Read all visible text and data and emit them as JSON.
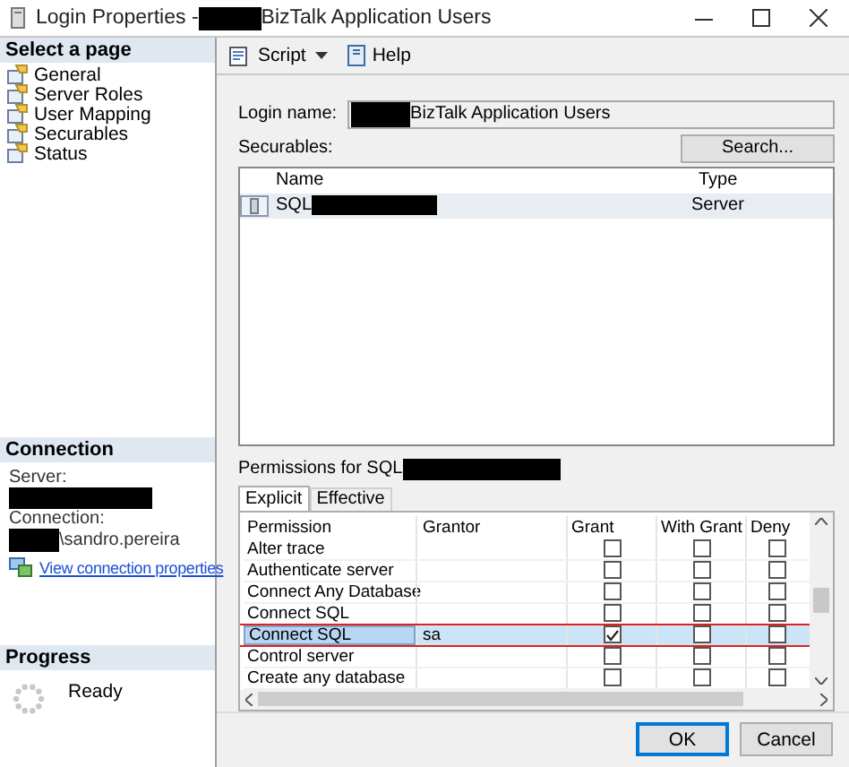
{
  "window": {
    "title": [
      {
        "kind": "text",
        "text": "Login Properties -"
      },
      {
        "kind": "redacted"
      },
      {
        "kind": "text",
        "text": "BizTalk Application Users"
      }
    ]
  },
  "sidebar": {
    "header": "Select a page",
    "items": [
      {
        "label": "General"
      },
      {
        "label": "Server Roles"
      },
      {
        "label": "User Mapping"
      },
      {
        "label": "Securables"
      },
      {
        "label": "Status"
      }
    ]
  },
  "connection": {
    "header": "Connection",
    "server_label": "Server:",
    "server_value": [
      {
        "kind": "redacted"
      }
    ],
    "connection_label": "Connection:",
    "connection_value": [
      {
        "kind": "redacted"
      },
      {
        "kind": "text",
        "text": "\\sandro.pereira"
      }
    ],
    "link": "View connection properties"
  },
  "progress": {
    "header": "Progress",
    "status": "Ready"
  },
  "toolbar": {
    "buttons": [
      {
        "label": "Script",
        "kind": "menu"
      },
      {
        "label": "Help",
        "kind": "plain"
      }
    ]
  },
  "login_name": {
    "label": "Login name:",
    "value": [
      {
        "kind": "redacted"
      },
      {
        "kind": "text",
        "text": "BizTalk Application Users"
      }
    ]
  },
  "securables": {
    "label": "Securables:",
    "search_button": "Search...",
    "columns": [
      "Name",
      "Type"
    ],
    "rows": [
      {
        "name": [
          {
            "kind": "text",
            "text": "SQL"
          },
          {
            "kind": "redacted"
          }
        ],
        "type": "Server",
        "selected": true
      }
    ]
  },
  "permissions": {
    "label": [
      {
        "kind": "text",
        "text": "Permissions for SQL"
      },
      {
        "kind": "redacted"
      }
    ],
    "tabs": [
      {
        "label": "Explicit",
        "selected": true
      },
      {
        "label": "Effective",
        "selected": false
      }
    ],
    "columns": [
      "Permission",
      "Grantor",
      "Grant",
      "With Grant",
      "Deny"
    ],
    "rows": [
      {
        "permission": "Alter trace",
        "grant": false,
        "with_grant": false,
        "deny": false,
        "selected": false,
        "annotated": false
      },
      {
        "permission": "Authenticate server",
        "grant": false,
        "with_grant": false,
        "deny": false,
        "selected": false,
        "annotated": false
      },
      {
        "permission": "Connect Any Database",
        "grant": false,
        "with_grant": false,
        "deny": false,
        "selected": false,
        "annotated": false
      },
      {
        "permission": "Connect SQL",
        "grant": false,
        "with_grant": false,
        "deny": false,
        "selected": false,
        "annotated": false
      },
      {
        "permission": "Connect SQL",
        "grantor": "sa",
        "grant": true,
        "with_grant": false,
        "deny": false,
        "selected": true,
        "annotated": true
      },
      {
        "permission": "Control server",
        "grant": false,
        "with_grant": false,
        "deny": false,
        "selected": false,
        "annotated": false
      },
      {
        "permission": "Create any database",
        "grant": false,
        "with_grant": false,
        "deny": false,
        "selected": false,
        "annotated": false
      }
    ]
  },
  "buttons": [
    {
      "label": "OK",
      "default": true
    },
    {
      "label": "Cancel",
      "default": false
    }
  ]
}
